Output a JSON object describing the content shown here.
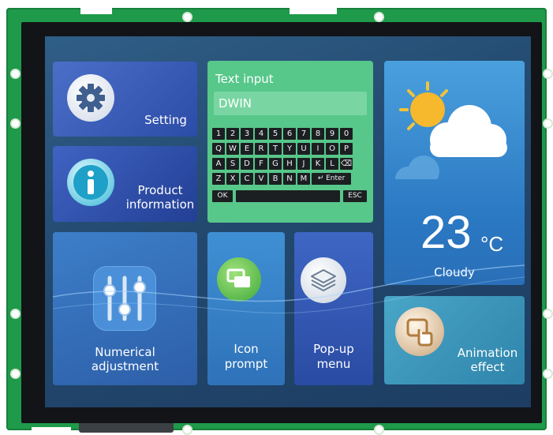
{
  "tiles": {
    "setting": {
      "label": "Setting",
      "icon": "gear-icon"
    },
    "product": {
      "label_line1": "Product",
      "label_line2": "information",
      "icon": "info-icon"
    },
    "text_input": {
      "title": "Text input",
      "value": "DWIN",
      "keyboard": {
        "row1": [
          "1",
          "2",
          "3",
          "4",
          "5",
          "6",
          "7",
          "8",
          "9",
          "0"
        ],
        "row2": [
          "Q",
          "W",
          "E",
          "R",
          "T",
          "Y",
          "U",
          "I",
          "O",
          "P"
        ],
        "row3": [
          "A",
          "S",
          "D",
          "F",
          "G",
          "H",
          "J",
          "K",
          "L",
          "⌫"
        ],
        "row4": [
          "Z",
          "X",
          "C",
          "V",
          "B",
          "N",
          "M"
        ],
        "enter": "↵ Enter",
        "ok": "OK",
        "esc": "ESC"
      }
    },
    "weather": {
      "temperature": "23",
      "unit": "°C",
      "condition": "Cloudy",
      "icon": "sun-cloud-icon"
    },
    "numerical": {
      "label_line1": "Numerical",
      "label_line2": "adjustment",
      "icon": "sliders-icon"
    },
    "icon_prompt": {
      "label_line1": "Icon",
      "label_line2": "prompt",
      "icon": "window-icon"
    },
    "popup": {
      "label_line1": "Pop-up",
      "label_line2": "menu",
      "icon": "layers-icon"
    },
    "animation": {
      "label_line1": "Animation",
      "label_line2": "effect",
      "icon": "touch-icon"
    }
  },
  "colors": {
    "pcb": "#1f9a4a",
    "bezel": "#121418",
    "keyboard_bg": "#57c78a",
    "key": "#1c1f22"
  }
}
